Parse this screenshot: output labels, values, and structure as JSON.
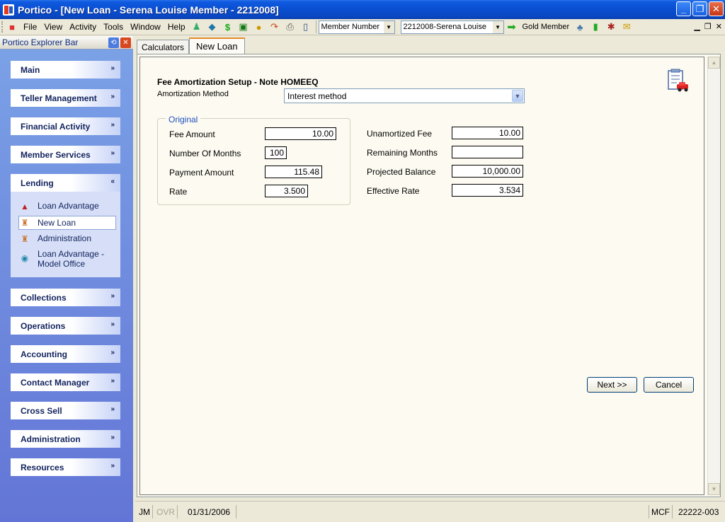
{
  "window": {
    "title": "Portico - [New Loan - Serena Louise Member - 2212008]"
  },
  "menu": {
    "items": [
      "File",
      "View",
      "Activity",
      "Tools",
      "Window",
      "Help"
    ],
    "search_type": "Member Number",
    "member_select": "2212008-Serena Louise",
    "tier": "Gold Member"
  },
  "explorer": {
    "title": "Portico Explorer Bar",
    "groups": [
      "Main",
      "Teller Management",
      "Financial Activity",
      "Member Services",
      "Lending",
      "Collections",
      "Operations",
      "Accounting",
      "Contact Manager",
      "Cross Sell",
      "Administration",
      "Resources"
    ],
    "lending_items": [
      "Loan Advantage",
      "New Loan",
      "Administration",
      "Loan Advantage -",
      "Model Office"
    ]
  },
  "tabs": [
    "Calculators",
    "New Loan"
  ],
  "form": {
    "heading": "Fee Amortization Setup - Note HOMEEQ",
    "method_label": "Amortization Method",
    "method_value": "Interest method",
    "group_title": "Original",
    "left": [
      {
        "label": "Fee Amount",
        "value": "10.00"
      },
      {
        "label": "Number Of Months",
        "value": "100"
      },
      {
        "label": "Payment Amount",
        "value": "115.48"
      },
      {
        "label": "Rate",
        "value": "3.500"
      }
    ],
    "right": [
      {
        "label": "Unamortized Fee",
        "value": "10.00"
      },
      {
        "label": "Remaining Months",
        "value": ""
      },
      {
        "label": "Projected Balance",
        "value": "10,000.00"
      },
      {
        "label": "Effective Rate",
        "value": "3.534"
      }
    ],
    "next_label": "Next >>",
    "cancel_label": "Cancel"
  },
  "status": {
    "user": "JM",
    "ovr": "OVR",
    "date": "01/31/2006",
    "mcf": "MCF",
    "code": "22222-003"
  },
  "colors": {
    "title_bar": "#0a4ed0",
    "explorer_bg": "#7ba2e7",
    "legend": "#1e4fc0",
    "active_tab_accent": "#e68b2c"
  }
}
